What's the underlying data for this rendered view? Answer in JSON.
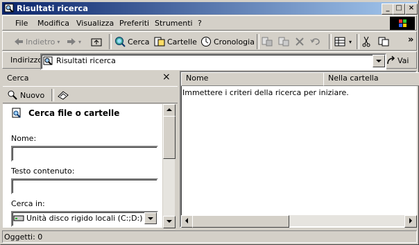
{
  "window": {
    "title": "Risultati ricerca",
    "controls": {
      "minimize": "_",
      "maximize": "□",
      "close": "×"
    }
  },
  "menu": {
    "items": [
      {
        "label": "File"
      },
      {
        "label": "Modifica"
      },
      {
        "label": "Visualizza"
      },
      {
        "label": "Preferiti"
      },
      {
        "label": "Strumenti"
      },
      {
        "label": "?"
      }
    ]
  },
  "toolbar": {
    "back_label": "Indietro",
    "search_label": "Cerca",
    "folders_label": "Cartelle",
    "history_label": "Cronologia",
    "more": "»"
  },
  "address": {
    "label": "Indirizzo",
    "value": "Risultati ricerca",
    "go_label": "Vai"
  },
  "search_pane": {
    "title": "Cerca",
    "close": "×",
    "new_label": "Nuovo",
    "heading": "Cerca file o cartelle",
    "name_label": "Nome:",
    "name_value": "",
    "content_label": "Testo contenuto:",
    "content_value": "",
    "look_in_label": "Cerca in:",
    "look_in_value": "Unità disco rigido locali (C:;D:)"
  },
  "results": {
    "columns": [
      "Nome",
      "Nella cartella"
    ],
    "message": "Immettere i criteri della ricerca per iniziare."
  },
  "status": {
    "text": "Oggetti: 0"
  },
  "colors": {
    "title_start": "#0a246a",
    "title_end": "#a6caf0",
    "face": "#d4d0c8"
  }
}
